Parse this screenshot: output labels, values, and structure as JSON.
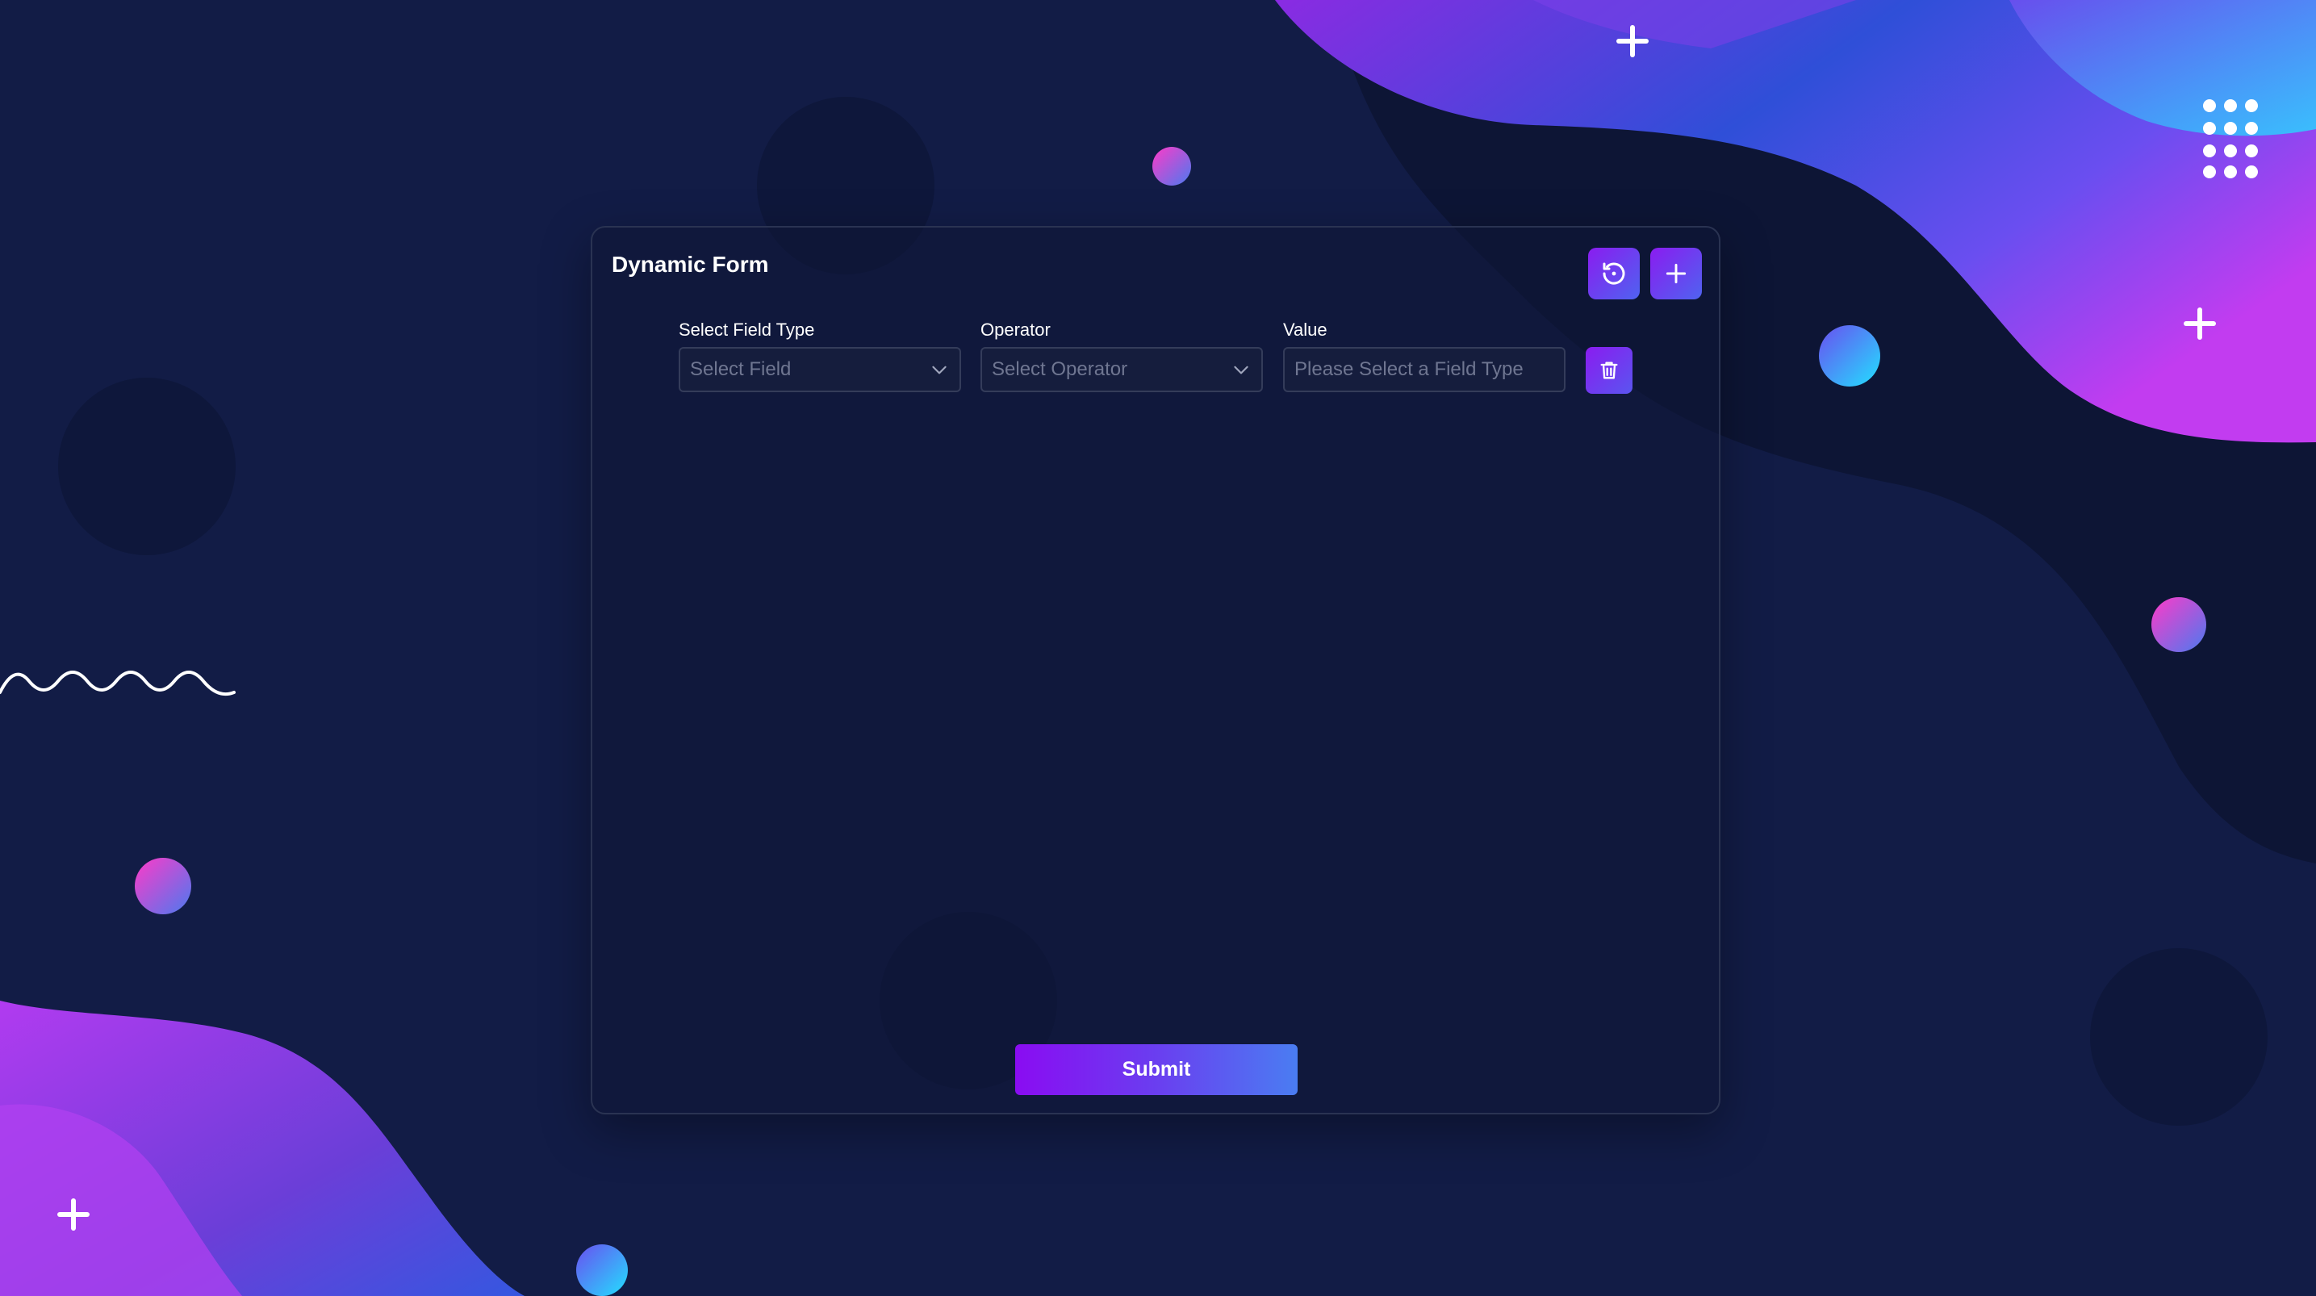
{
  "form": {
    "title": "Dynamic Form",
    "reset_icon": "reset-icon",
    "add_icon": "plus-icon",
    "fields": {
      "field_type_label": "Select Field Type",
      "field_type_value": "Select Field",
      "operator_label": "Operator",
      "operator_value": "Select Operator",
      "value_label": "Value",
      "value_placeholder": "Please Select a Field Type"
    },
    "delete_icon": "trash-icon",
    "submit_label": "Submit"
  },
  "colors": {
    "background": "#121c46",
    "accent_purple": "#8a1cf0",
    "accent_blue": "#4f63f0"
  }
}
